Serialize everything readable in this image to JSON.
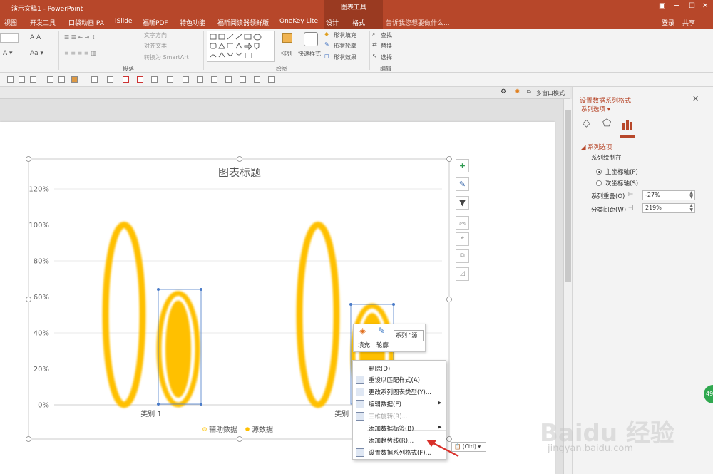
{
  "window": {
    "doc_title": "演示文稿1 - PowerPoint",
    "chart_tools_label": "图表工具",
    "restore_icon": "restore-icon",
    "minimize_icon": "minimize-icon",
    "maximize_icon": "maximize-icon",
    "close_icon": "close-icon"
  },
  "tabs": [
    "视图",
    "开发工具",
    "口袋动画 PA",
    "iSlide",
    "福昕PDF",
    "特色功能",
    "福昕阅读器领鲜版",
    "OneKey Lite",
    "设计",
    "格式"
  ],
  "tell_me": "告诉我您想要做什么...",
  "account": {
    "login": "登录",
    "share": "共享"
  },
  "ribbon": {
    "paragraph": {
      "text_direction": "文字方向",
      "align_text": "对齐文本",
      "convert_smartart": "转换为 SmartArt",
      "label": "段落"
    },
    "drawing": {
      "arrange": "排列",
      "quick_styles": "快速样式",
      "shape_fill": "形状填充",
      "shape_outline": "形状轮廓",
      "shape_effects": "形状效果",
      "label": "绘图"
    },
    "editing": {
      "find": "查找",
      "replace": "替换",
      "select": "选择",
      "label": "编辑"
    }
  },
  "viewbar": {
    "multi_window": "多窗口模式"
  },
  "chart_data": {
    "type": "bar",
    "title": "图表标题",
    "categories": [
      "类别 1",
      "类别 2"
    ],
    "series": [
      {
        "name": "辅助数据",
        "values": [
          1.0,
          1.0
        ]
      },
      {
        "name": "源数据",
        "values": [
          0.62,
          0.55
        ]
      }
    ],
    "yticks": [
      "0%",
      "20%",
      "40%",
      "60%",
      "80%",
      "100%",
      "120%"
    ],
    "ylim": [
      0,
      1.2
    ],
    "series_overlap": "-27%",
    "gap_width": "219%",
    "color": "#ffc000",
    "legend_position": "bottom",
    "grid": true
  },
  "chart_buttons": {
    "add_element_icon": "plus-icon",
    "style_icon": "brush-icon",
    "filter_icon": "filter-icon",
    "collapse_icon": "chevron-up-icon",
    "crop_icon": "anchor-icon",
    "layers_icon": "layers-icon",
    "resize_icon": "resize-icon"
  },
  "mini_toolbar": {
    "fill": "填充",
    "outline": "轮廓",
    "series_dropdown": "系列 \"源"
  },
  "context_menu": {
    "items": [
      {
        "label": "删除(D)",
        "enabled": true,
        "submenu": false
      },
      {
        "label": "重设以匹配样式(A)",
        "enabled": true,
        "submenu": false
      },
      {
        "label": "更改系列图表类型(Y)...",
        "enabled": true,
        "submenu": false
      },
      {
        "label": "编辑数据(E)",
        "enabled": true,
        "submenu": true
      },
      {
        "label": "三维旋转(R)...",
        "enabled": false,
        "submenu": false
      },
      {
        "label": "添加数据标签(B)",
        "enabled": true,
        "submenu": true
      },
      {
        "label": "添加趋势线(R)...",
        "enabled": true,
        "submenu": false
      },
      {
        "label": "设置数据系列格式(F)...",
        "enabled": true,
        "submenu": false
      }
    ]
  },
  "paste_options": "(Ctrl)",
  "format_pane": {
    "title": "设置数据系列格式",
    "subtitle": "系列选项",
    "section": "系列选项",
    "plot_on": "系列绘制在",
    "primary_axis": "主坐标轴(P)",
    "secondary_axis": "次坐标轴(S)",
    "overlap_label": "系列重叠(O)",
    "overlap_value": "-27%",
    "gap_label": "分类间距(W)",
    "gap_value": "219%"
  },
  "watermark": {
    "brand": "Baidu 经验",
    "url": "jingyan.baidu.com"
  },
  "badge": "49"
}
